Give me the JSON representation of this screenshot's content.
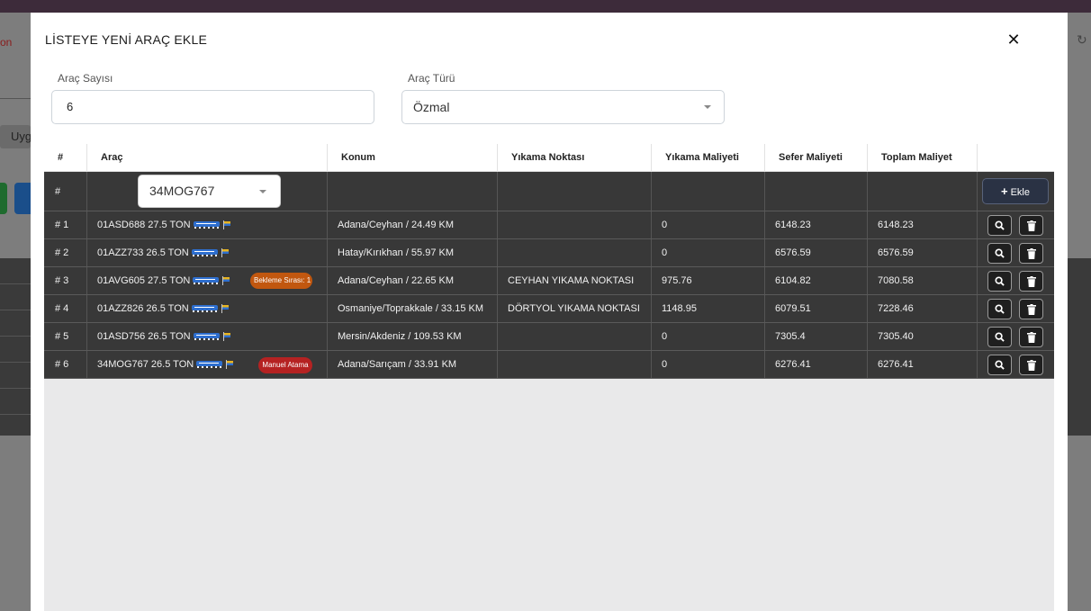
{
  "background": {
    "left_text": "on",
    "uyg_text": "Uyg"
  },
  "modal": {
    "title": "LİSTEYE YENİ ARAÇ EKLE",
    "close_symbol": "✕"
  },
  "form": {
    "count_label": "Araç Sayısı",
    "count_value": "6",
    "type_label": "Araç Türü",
    "type_value": "Özmal"
  },
  "table": {
    "headers": [
      "#",
      "Araç",
      "Konum",
      "Yıkama Noktası",
      "Yıkama Maliyeti",
      "Sefer Maliyeti",
      "Toplam Maliyet",
      ""
    ],
    "add_row": {
      "index": "#",
      "selected_vehicle": "34MOG767",
      "add_button_label": "Ekle",
      "add_button_icon": "plus-icon"
    },
    "rows": [
      {
        "index": "# 1",
        "vehicle": "01ASD688 27.5 TON",
        "badge": "",
        "location": "Adana/Ceyhan / 24.49 KM",
        "wash_point": "",
        "wash_cost": "0",
        "trip_cost": "6148.23",
        "total_cost": "6148.23"
      },
      {
        "index": "# 2",
        "vehicle": "01AZZ733 26.5 TON",
        "badge": "",
        "location": "Hatay/Kırıkhan / 55.97 KM",
        "wash_point": "",
        "wash_cost": "0",
        "trip_cost": "6576.59",
        "total_cost": "6576.59"
      },
      {
        "index": "# 3",
        "vehicle": "01AVG605 27.5 TON",
        "badge": "Bekleme Sırası: 1",
        "location": "Adana/Ceyhan / 22.65 KM",
        "wash_point": "CEYHAN YIKAMA NOKTASI",
        "wash_cost": "975.76",
        "trip_cost": "6104.82",
        "total_cost": "7080.58"
      },
      {
        "index": "# 4",
        "vehicle": "01AZZ826 26.5 TON",
        "badge": "",
        "location": "Osmaniye/Toprakkale / 33.15 KM",
        "wash_point": "DÖRTYOL YIKAMA NOKTASI",
        "wash_cost": "1148.95",
        "trip_cost": "6079.51",
        "total_cost": "7228.46"
      },
      {
        "index": "# 5",
        "vehicle": "01ASD756 26.5 TON",
        "badge": "",
        "location": "Mersin/Akdeniz / 109.53 KM",
        "wash_point": "",
        "wash_cost": "0",
        "trip_cost": "7305.4",
        "total_cost": "7305.40"
      },
      {
        "index": "# 6",
        "vehicle": "34MOG767 26.5 TON",
        "badge": "Manuel Atama",
        "location": "Adana/Sarıçam / 33.91 KM",
        "wash_point": "",
        "wash_cost": "0",
        "trip_cost": "6276.41",
        "total_cost": "6276.41"
      }
    ]
  },
  "colors": {
    "row_bg": "#383838",
    "badge_wait": "#c1570f",
    "badge_manual": "#b52222",
    "add_button": "#2a3244"
  }
}
